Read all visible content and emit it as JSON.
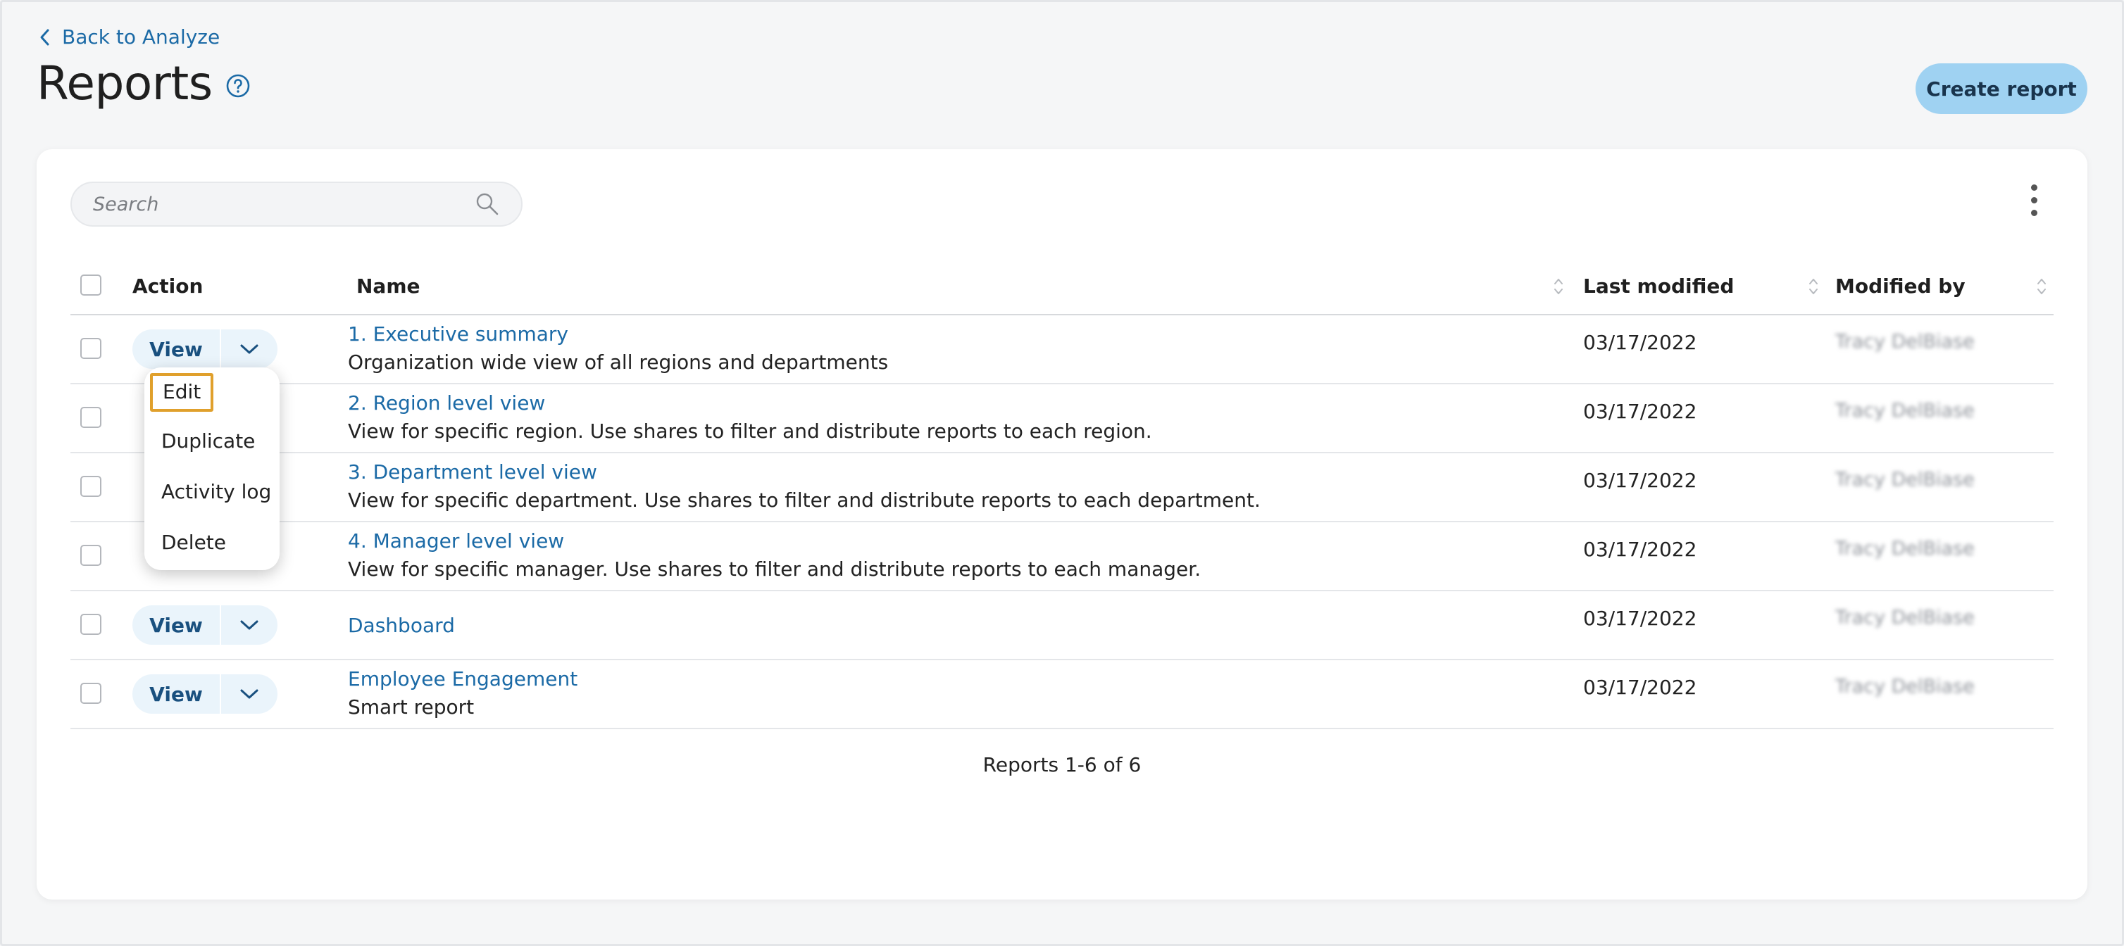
{
  "nav": {
    "back_label": "Back to Analyze"
  },
  "header": {
    "title": "Reports",
    "create_label": "Create report"
  },
  "search": {
    "placeholder": "Search"
  },
  "table": {
    "columns": {
      "action": "Action",
      "name": "Name",
      "last_modified": "Last modified",
      "modified_by": "Modified by"
    },
    "view_label": "View",
    "rows": [
      {
        "name": "1. Executive summary",
        "description": "Organization wide view of all regions and departments",
        "date": "03/17/2022",
        "modified_by": "Tracy DelBiase"
      },
      {
        "name": "2. Region level view",
        "description": "View for specific region. Use shares to filter and distribute reports to each region.",
        "date": "03/17/2022",
        "modified_by": "Tracy DelBiase"
      },
      {
        "name": "3. Department level view",
        "description": "View for specific department. Use shares to filter and distribute reports to each department.",
        "date": "03/17/2022",
        "modified_by": "Tracy DelBiase"
      },
      {
        "name": "4. Manager level view",
        "description": "View for specific manager. Use shares to filter and distribute reports to each manager.",
        "date": "03/17/2022",
        "modified_by": "Tracy DelBiase"
      },
      {
        "name": "Dashboard",
        "description": "",
        "date": "03/17/2022",
        "modified_by": "Tracy DelBiase"
      },
      {
        "name": "Employee Engagement",
        "description": "Smart report",
        "date": "03/17/2022",
        "modified_by": "Tracy DelBiase"
      }
    ],
    "footer": "Reports 1-6 of 6"
  },
  "dropdown_menu": {
    "items": [
      "Edit",
      "Duplicate",
      "Activity log",
      "Delete"
    ],
    "focused_item": "Edit"
  },
  "colors": {
    "link": "#1b6aa6",
    "primary_button": "#9fd2f2",
    "focus_ring": "#e0a02c"
  }
}
